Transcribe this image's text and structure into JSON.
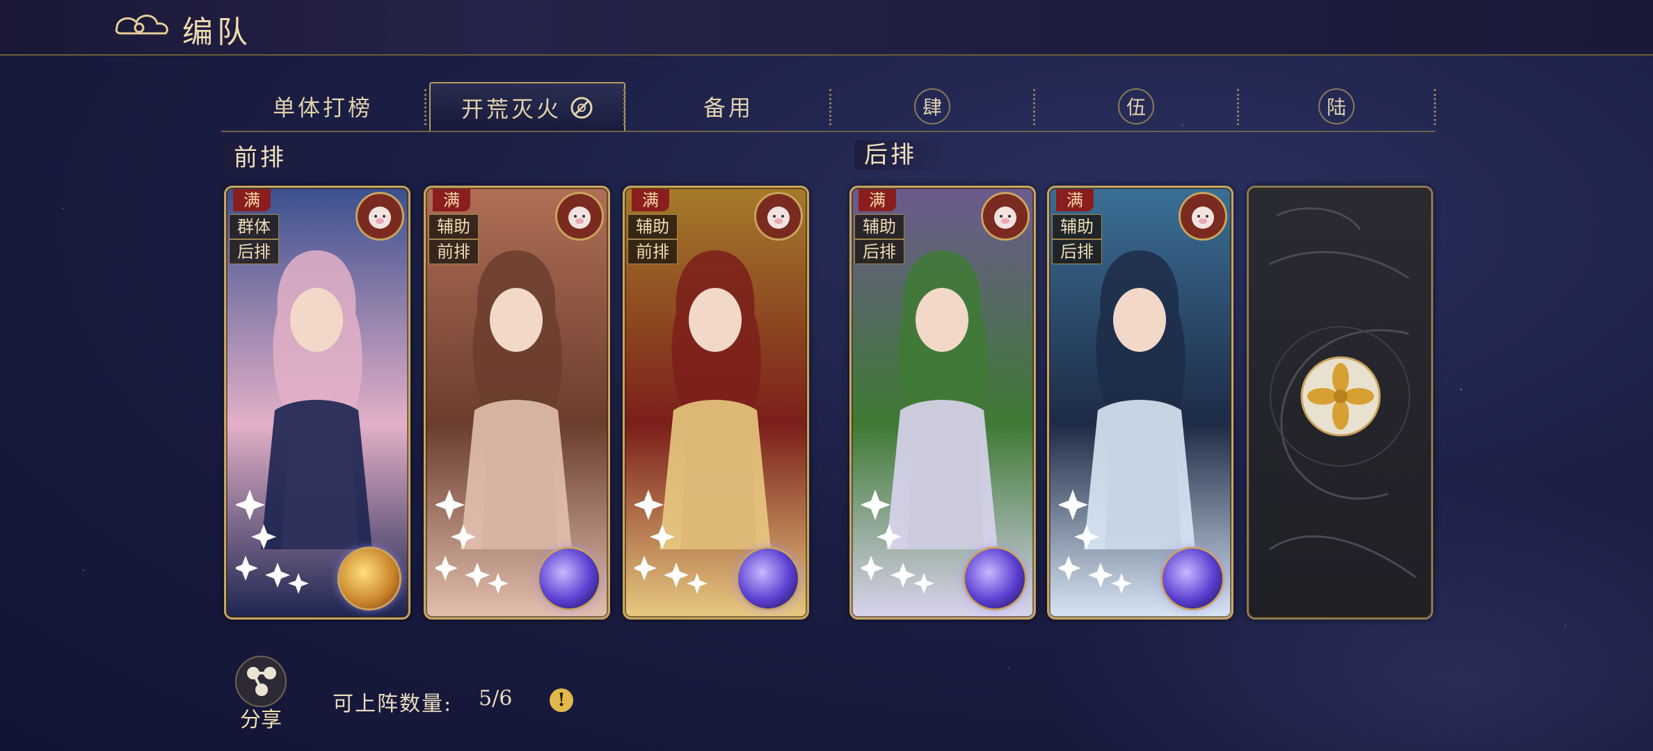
{
  "header": {
    "title": "编队"
  },
  "tabs": [
    {
      "label": "单体打榜",
      "active": false
    },
    {
      "label": "开荒灭火",
      "active": true
    },
    {
      "label": "备用",
      "active": false
    },
    {
      "label": "肆",
      "active": false
    },
    {
      "label": "伍",
      "active": false
    },
    {
      "label": "陆",
      "active": false
    }
  ],
  "sections": {
    "front": "前排",
    "back": "后排"
  },
  "cards": [
    {
      "badge": "满",
      "tags": [
        "群体",
        "后排"
      ],
      "beast_icon": "pig-icon",
      "orb": "gold-orb",
      "palette": [
        "#3a4f8e",
        "#1c2550",
        "#e3b0c8"
      ]
    },
    {
      "badge": "满",
      "tags": [
        "辅助",
        "前排"
      ],
      "beast_icon": "pig-icon",
      "orb": "purple-orb",
      "palette": [
        "#b06f55",
        "#e2bfae",
        "#6b3d2e"
      ]
    },
    {
      "badge": "满",
      "tags": [
        "辅助",
        "前排"
      ],
      "beast_icon": "monkey-icon",
      "orb": "purple-orb",
      "palette": [
        "#a57b2a",
        "#e8c980",
        "#7b1f1a"
      ]
    },
    {
      "badge": "满",
      "tags": [
        "辅助",
        "后排"
      ],
      "beast_icon": "rooster-icon",
      "orb": "purple-orb",
      "palette": [
        "#6c5a8f",
        "#dad4ee",
        "#3e7a34"
      ]
    },
    {
      "badge": "满",
      "tags": [
        "辅助",
        "后排"
      ],
      "beast_icon": "rat-icon",
      "orb": "purple-orb",
      "palette": [
        "#3b6f96",
        "#d8e6f4",
        "#1d2b46"
      ]
    }
  ],
  "footer": {
    "share_label": "分享",
    "deploy_count_label": "可上阵数量:",
    "deploy_count_value": "5/6",
    "info_icon": "exclamation-icon"
  },
  "colors": {
    "gold_border": "#c9a55e",
    "badge_red": "#8a1e1e",
    "bg": "#1b1f45"
  }
}
